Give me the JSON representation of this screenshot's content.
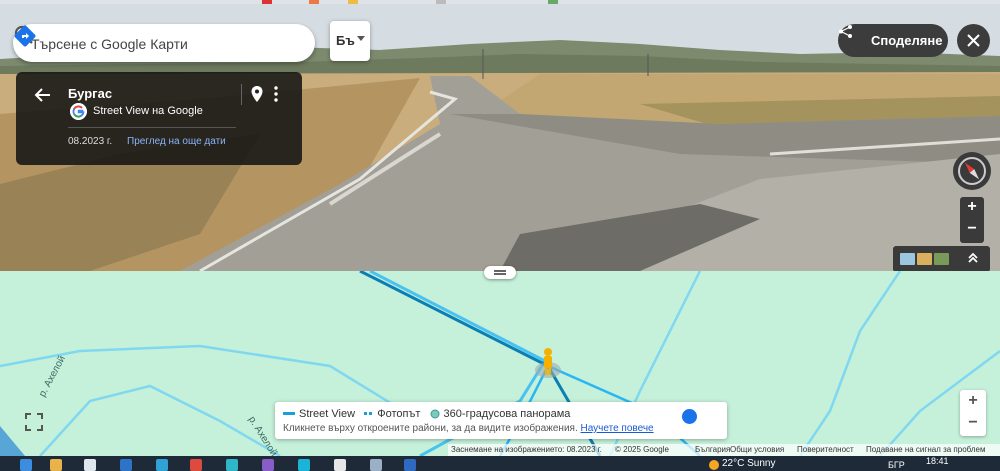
{
  "search": {
    "placeholder": "Търсене с Google Карти"
  },
  "layers": {
    "label": "Бъ"
  },
  "share": {
    "label": "Споделяне"
  },
  "info": {
    "location": "Бургас",
    "source": "Street View на Google",
    "date": "08.2023 г.",
    "see_more": "Преглед на още дати"
  },
  "pano_zoom": {
    "plus": "+",
    "minus": "−"
  },
  "map": {
    "road_label_1": "р. Ахелой",
    "road_label_2": "р. Ахелой"
  },
  "map_zoom": {
    "plus": "+",
    "minus": "−"
  },
  "legend": {
    "street_view": "Street View",
    "photo_path": "Фотопът",
    "panorama": "360-градусова панорама",
    "hint": "Кликнете върху откроените райони, за да видите изображения.",
    "learn_more": "Научете повече"
  },
  "credits": {
    "capture_date": "Заснемане на изображението: 08.2023 г.",
    "copyright": "© 2025 Google",
    "country": "България",
    "terms": "Общи условия",
    "privacy": "Поверителност",
    "report": "Подаване на сигнал за проблем"
  },
  "taskbar": {
    "weather": "22°C  Sunny",
    "lang": "БГР",
    "time": "18:41"
  },
  "colors": {
    "map_bg": "#c5f0d9",
    "sv_line": "#19a0d8",
    "panel_dark": "#141414",
    "link": "#8ab4f8",
    "toggle": "#1a73e8"
  }
}
